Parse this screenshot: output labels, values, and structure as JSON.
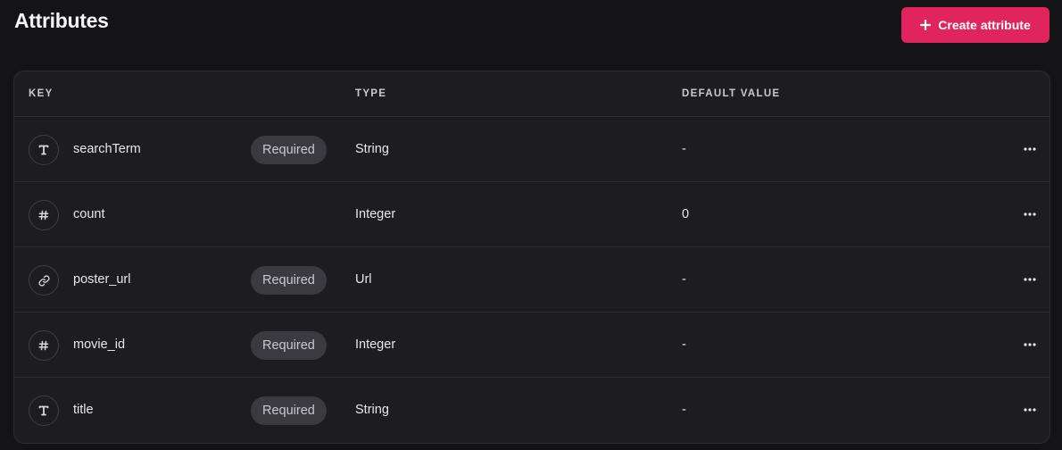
{
  "page": {
    "title": "Attributes",
    "create_button_label": "Create attribute",
    "create_button_icon": "plus-icon"
  },
  "colors": {
    "background": "#141416",
    "card": "#1d1d21",
    "accent": "#e0245e",
    "badge": "#3a3a40",
    "border": "#2e2e33"
  },
  "table": {
    "headers": {
      "key": "KEY",
      "type": "TYPE",
      "default": "DEFAULT VALUE"
    },
    "rows": [
      {
        "icon": "text-icon",
        "key": "searchTerm",
        "required": "Required",
        "type": "String",
        "default": "-"
      },
      {
        "icon": "hash-icon",
        "key": "count",
        "required": "",
        "type": "Integer",
        "default": "0"
      },
      {
        "icon": "link-icon",
        "key": "poster_url",
        "required": "Required",
        "type": "Url",
        "default": "-"
      },
      {
        "icon": "hash-icon",
        "key": "movie_id",
        "required": "Required",
        "type": "Integer",
        "default": "-"
      },
      {
        "icon": "text-icon",
        "key": "title",
        "required": "Required",
        "type": "String",
        "default": "-"
      }
    ],
    "row_menu_icon": "more-horizontal-icon"
  }
}
